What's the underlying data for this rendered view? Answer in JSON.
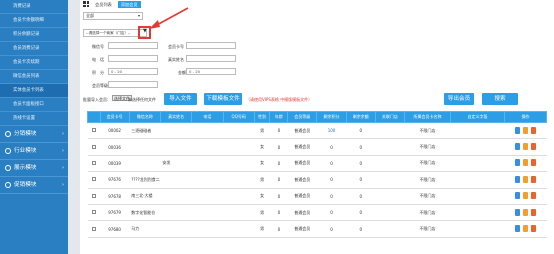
{
  "sidebar": {
    "items": [
      {
        "label": "消费记录"
      },
      {
        "label": "会员卡余额明细"
      },
      {
        "label": "积分余额记录"
      },
      {
        "label": "会员消费记录"
      },
      {
        "label": "会员卡次续期"
      },
      {
        "label": "微信会员列表"
      },
      {
        "label": "实体会员卡列表"
      },
      {
        "label": "会员卡面板接口"
      },
      {
        "label": "热线卡设置"
      }
    ],
    "sections": [
      {
        "label": "分销模块"
      },
      {
        "label": "行业模块"
      },
      {
        "label": "展示模块"
      },
      {
        "label": "促销模块"
      }
    ]
  },
  "tabs": [
    {
      "label": "会员列表"
    },
    {
      "label": "添加会员"
    }
  ],
  "filters": {
    "scope_select": "全部",
    "store_select": "--请选择一个商家（门店）--",
    "store_arrow": "▼",
    "fields": {
      "wechat_nick": {
        "label": "微信号",
        "value": ""
      },
      "card_no": {
        "label": "会员卡号",
        "value": ""
      },
      "phone": {
        "label": "电　话",
        "value": ""
      },
      "real_name": {
        "label": "真实姓名",
        "value": ""
      },
      "points": {
        "label": "积　分",
        "value": "0 - 20"
      },
      "balance": {
        "label": "金额",
        "value": "0 - 20"
      },
      "level": {
        "label": "会员等级",
        "value": ""
      }
    },
    "import_label": "批量导入会员:",
    "choose_file": "选择文件",
    "no_file": "未选择任何文件",
    "import_btn": "导入文件",
    "download_btn": "下载模板文件",
    "note": "（请使用VIPS表格 中模版模板文件）",
    "export_btn": "导出会员",
    "search_btn": "搜索"
  },
  "table": {
    "headers": [
      "",
      "会员卡号",
      "微信名称",
      "真实姓名",
      "电话",
      "QQ号码",
      "性别",
      "年龄",
      "会员等级",
      "剩余积分",
      "剩余余额",
      "关联门店",
      "所属会员卡名称",
      "自定义字段",
      "操作"
    ],
    "rows": [
      [
        "",
        "00002",
        "三逐碰碰者",
        "",
        "",
        "",
        "男",
        "0",
        "普通会员",
        "100",
        "0",
        "",
        "不限门店",
        "",
        ""
      ],
      [
        "",
        "00036",
        "",
        "",
        "",
        "",
        "女",
        "0",
        "普通会员",
        "0",
        "0",
        "",
        "不限门店",
        "",
        ""
      ],
      [
        "",
        "00039",
        "",
        "安发",
        "",
        "",
        "女",
        "0",
        "普通会员",
        "0",
        "0",
        "",
        "不限门店",
        "",
        ""
      ],
      [
        "",
        "97676",
        "????龙烈烈食二",
        "",
        "",
        "",
        "男",
        "0",
        "普通会员",
        "0",
        "0",
        "",
        "不限门店",
        "",
        ""
      ],
      [
        "",
        "97678",
        "南三北·大楼",
        "",
        "",
        "",
        "女",
        "0",
        "普通会员",
        "0",
        "0",
        "",
        "不限门店",
        "",
        ""
      ],
      [
        "",
        "97679",
        "数字化智能仓",
        "",
        "",
        "",
        "男",
        "0",
        "普通会员",
        "0",
        "0",
        "",
        "不限门店",
        "",
        ""
      ],
      [
        "",
        "97680",
        "马力",
        "",
        "",
        "",
        "男",
        "0",
        "普通会员",
        "0",
        "0",
        "",
        "不限门店",
        "",
        ""
      ]
    ]
  },
  "colors": {
    "sidebar": "#2a7fc2",
    "accent": "#2b9ee6",
    "alert": "#e53935"
  }
}
